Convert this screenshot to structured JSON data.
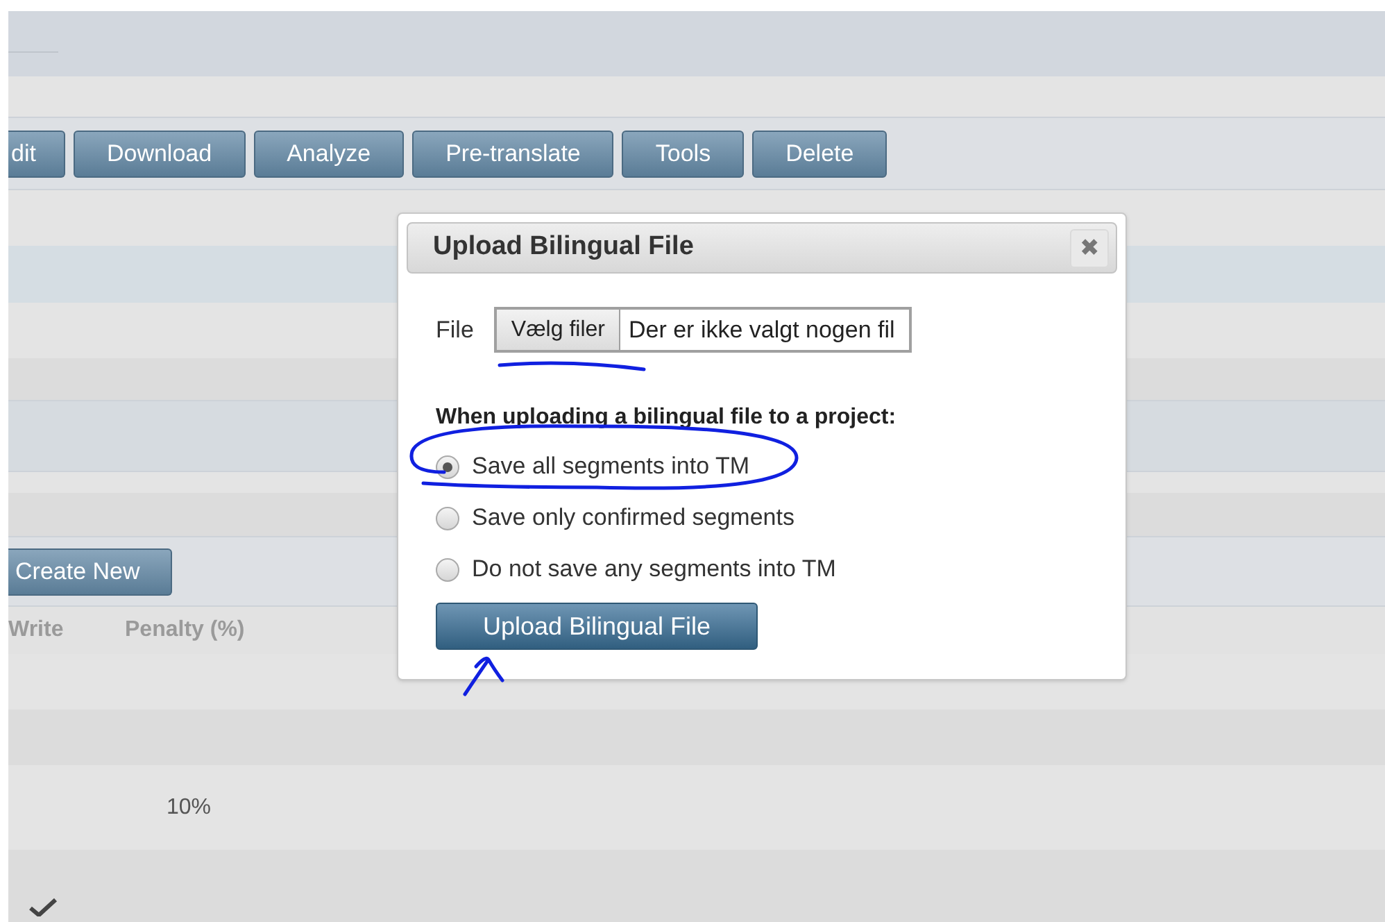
{
  "toolbar": {
    "buttons": [
      "dit",
      "Download",
      "Analyze",
      "Pre-translate",
      "Tools",
      "Delete"
    ]
  },
  "section": {
    "create_button": "Create New",
    "columns": [
      "Write",
      "Penalty (%)"
    ],
    "rows": [
      {
        "penalty": "10%"
      }
    ]
  },
  "dialog": {
    "title": "Upload Bilingual File",
    "close": "✖",
    "file_label": "File",
    "choose_button": "Vælg filer",
    "file_status": "Der er ikke valgt nogen fil",
    "question": "When uploading a bilingual file to a project:",
    "options": [
      {
        "label": "Save all segments into TM",
        "selected": true
      },
      {
        "label": "Save only confirmed segments",
        "selected": false
      },
      {
        "label": "Do not save any segments into TM",
        "selected": false
      }
    ],
    "submit": "Upload Bilingual File"
  }
}
